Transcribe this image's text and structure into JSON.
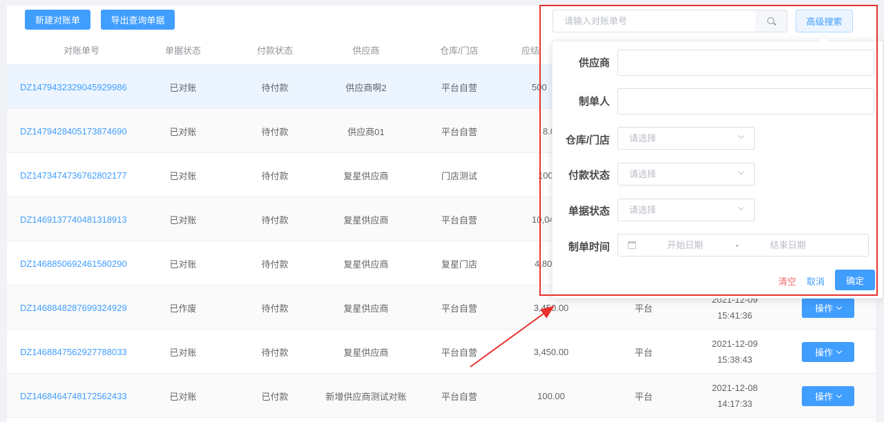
{
  "toolbar": {
    "new_label": "新建对账单",
    "export_label": "导出查询单据"
  },
  "search": {
    "placeholder": "请输入对账单号",
    "advanced_label": "高级搜索"
  },
  "table": {
    "headers": [
      "对账单号",
      "单据状态",
      "付款状态",
      "供应商",
      "仓库/门店",
      "应结"
    ],
    "rows": [
      {
        "id": "DZ1479432329045929986",
        "status": "已对账",
        "pay": "待付款",
        "supplier": "供应商啊2",
        "store": "平台自营",
        "amount": "500",
        "source": "",
        "time": "",
        "op": ""
      },
      {
        "id": "DZ1479428405173874690",
        "status": "已对账",
        "pay": "待付款",
        "supplier": "供应商01",
        "store": "平台自营",
        "amount": "8.0",
        "source": "",
        "time": "",
        "op": ""
      },
      {
        "id": "DZ1473474736762802177",
        "status": "已对账",
        "pay": "待付款",
        "supplier": "复星供应商",
        "store": "门店测试",
        "amount": "100",
        "source": "",
        "time": "",
        "op": ""
      },
      {
        "id": "DZ1469137740481318913",
        "status": "已对账",
        "pay": "待付款",
        "supplier": "复星供应商",
        "store": "平台自营",
        "amount": "10,04",
        "source": "",
        "time": "",
        "op": ""
      },
      {
        "id": "DZ1468850692461580290",
        "status": "已对账",
        "pay": "待付款",
        "supplier": "复星供应商",
        "store": "复星门店",
        "amount": "4,80",
        "source": "",
        "time": "",
        "op": ""
      },
      {
        "id": "DZ1468848287699324929",
        "status": "已作废",
        "pay": "待付款",
        "supplier": "复星供应商",
        "store": "平台自营",
        "amount": "3,450.00",
        "source": "平台",
        "time": "2021-12-09 15:41:36",
        "op": "操作"
      },
      {
        "id": "DZ1468847562927788033",
        "status": "已对账",
        "pay": "待付款",
        "supplier": "复星供应商",
        "store": "平台自营",
        "amount": "3,450.00",
        "source": "平台",
        "time": "2021-12-09 15:38:43",
        "op": "操作"
      },
      {
        "id": "DZ1468464748172562433",
        "status": "已对账",
        "pay": "已付款",
        "supplier": "新增供应商测试对账",
        "store": "平台自营",
        "amount": "100.00",
        "source": "平台",
        "time": "2021-12-08 14:17:33",
        "op": "操作"
      }
    ]
  },
  "advanced": {
    "supplier_label": "供应商",
    "creator_label": "制单人",
    "store_label": "仓库/门店",
    "pay_status_label": "付款状态",
    "doc_status_label": "单据状态",
    "time_label": "制单时间",
    "select_placeholder": "请选择",
    "start_placeholder": "开始日期",
    "range_sep": "-",
    "end_placeholder": "结束日期",
    "clear_label": "清空",
    "cancel_label": "取消",
    "confirm_label": "确定"
  },
  "colors": {
    "primary": "#409eff",
    "danger": "#f56c6c",
    "annotation": "#e8302c"
  }
}
